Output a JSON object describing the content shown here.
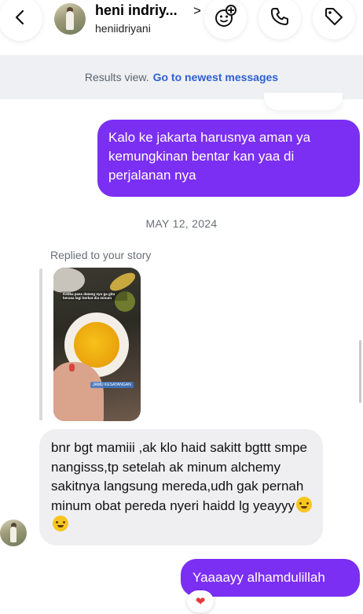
{
  "header": {
    "contact_name": "heni indriy...",
    "name_chevron": ">",
    "contact_handle": "heniidriyani",
    "icons": [
      "back-icon",
      "video-effects-icon",
      "phone-icon",
      "tag-icon"
    ]
  },
  "results_bar": {
    "text": "Results view.",
    "link": "Go to newest messages"
  },
  "messages": {
    "outgoing_1": "Kalo ke jakarta harusnya aman ya kemungkinan bentar kan yaa di perjalanan nya",
    "date_separator": "MAY 12, 2024",
    "replied_label": "Replied to your story",
    "story_caption": "Ketika pass datang nyo ga gitu berasa lagi berkat dia minum",
    "story_tag": "JAMU KESAYANGAN",
    "incoming_1": "bnr bgt mamiii ,ak klo haid sakitt bgttt smpe nangisss,tp setelah ak minum alchemy sakitnya langsung mereda,udh gak pernah minum obat pereda nyeri haidd lg yeayyy",
    "incoming_1_emojis": [
      "hugging-face-emoji",
      "hugging-face-emoji"
    ],
    "outgoing_2": "Yaaaayy alhamdulillah",
    "reaction": "❤"
  },
  "colors": {
    "outgoing_bubble": "#7b2ff2",
    "incoming_bubble": "#efeff1",
    "link": "#2d5fd3",
    "results_bg": "#eef0f3"
  }
}
